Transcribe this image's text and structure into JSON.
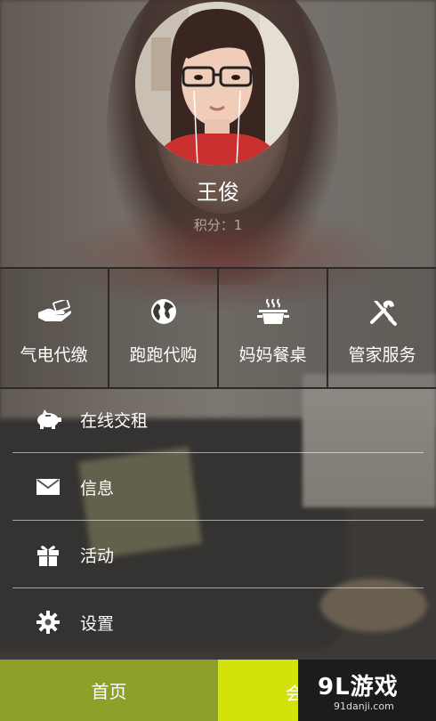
{
  "profile": {
    "name": "王俊",
    "points": "积分：1"
  },
  "services": [
    {
      "label": "气电代缴",
      "icon": "payment-hand-icon"
    },
    {
      "label": "跑跑代购",
      "icon": "globe-icon"
    },
    {
      "label": "妈妈餐桌",
      "icon": "cooking-pot-icon"
    },
    {
      "label": "管家服务",
      "icon": "tools-icon"
    }
  ],
  "menu": [
    {
      "label": "在线交租",
      "icon": "piggy-bank-icon"
    },
    {
      "label": "信息",
      "icon": "envelope-icon"
    },
    {
      "label": "活动",
      "icon": "gift-icon"
    },
    {
      "label": "设置",
      "icon": "gear-icon"
    }
  ],
  "tabbar": {
    "home_label": "首页",
    "member_label": "会",
    "home_color": "#8fa02a",
    "member_color": "#d3e20a"
  },
  "watermark": {
    "brand": "9L游戏",
    "site": "91danji.com"
  }
}
